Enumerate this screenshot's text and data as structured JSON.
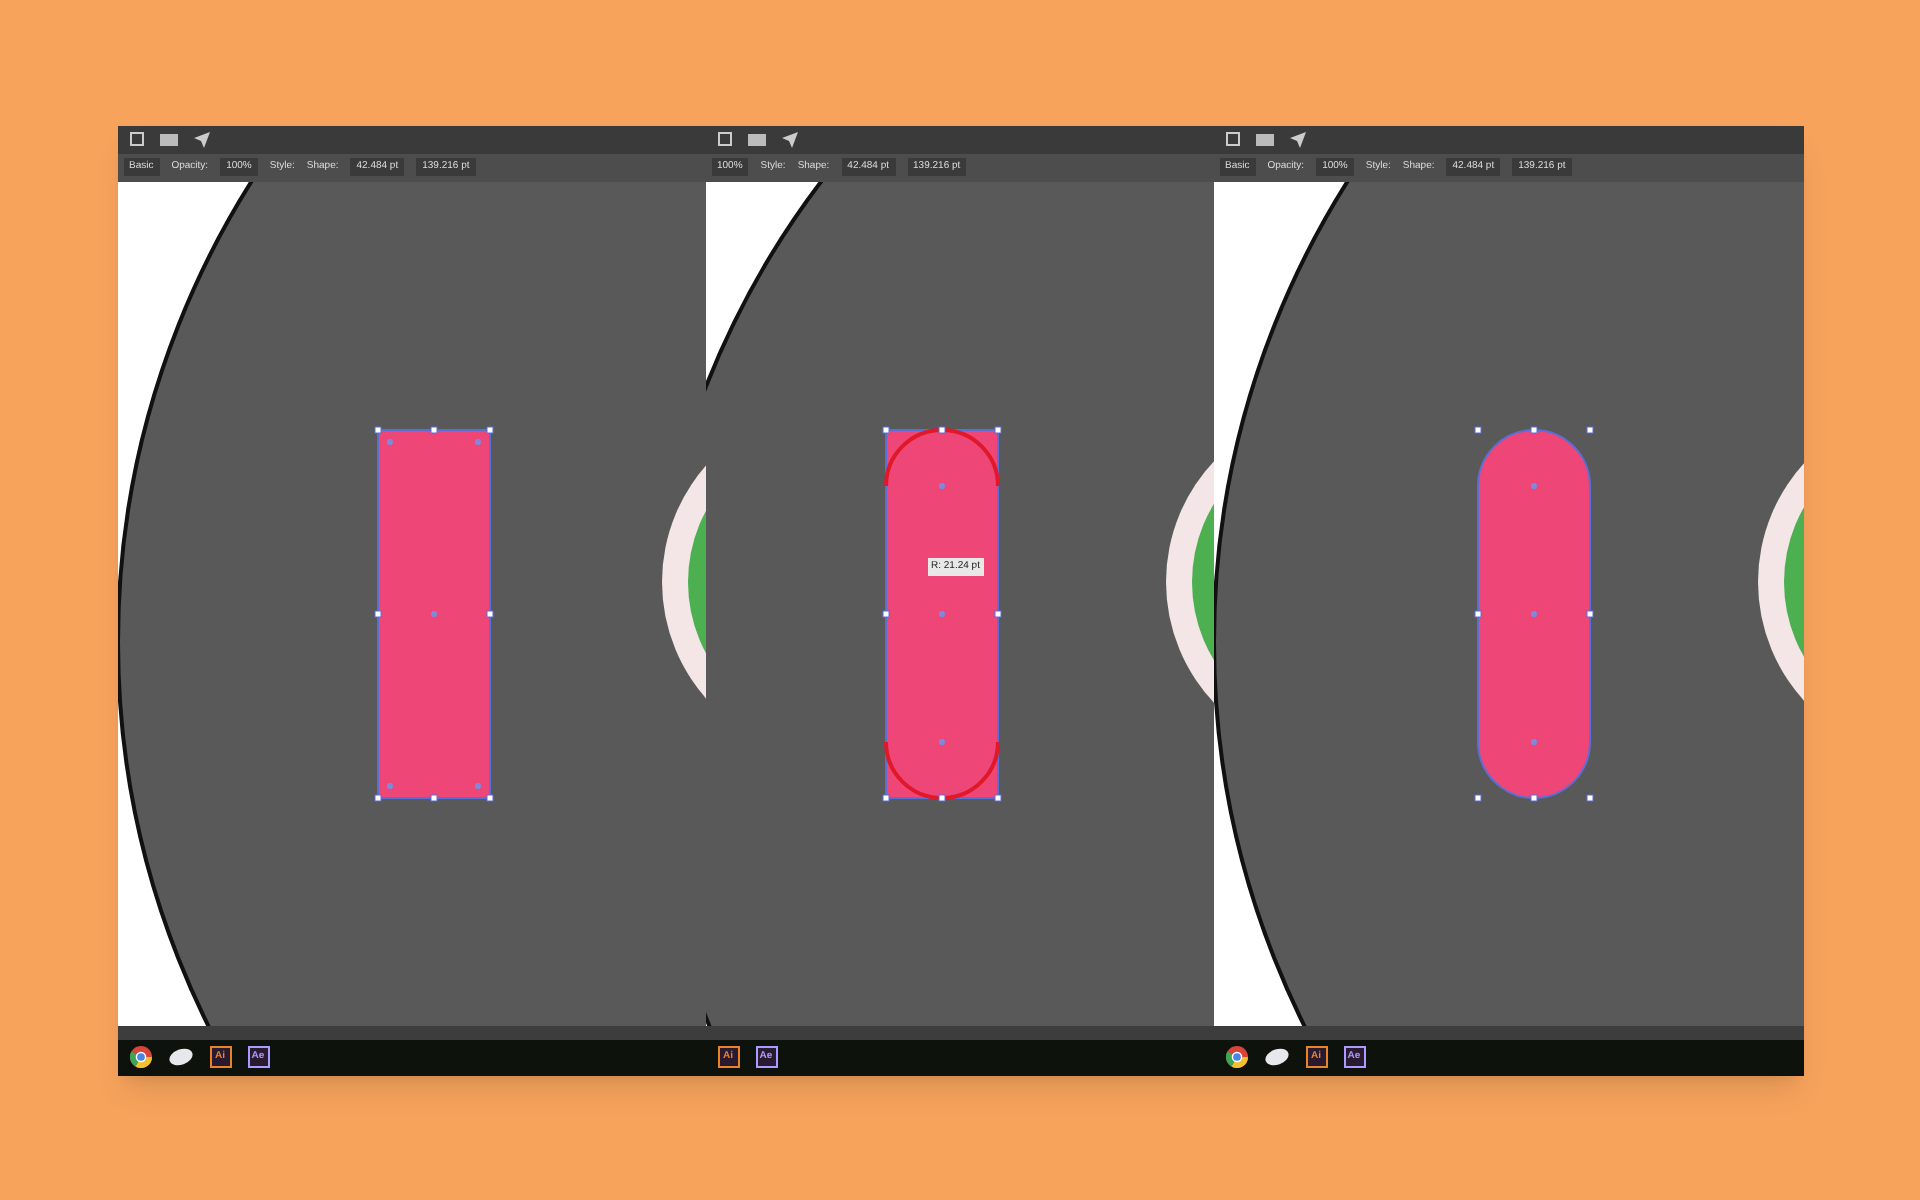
{
  "panels": [
    {
      "kind": "square",
      "controls": [
        {
          "kind": "field",
          "text": "Basic"
        },
        {
          "kind": "label",
          "text": "Opacity:"
        },
        {
          "kind": "field",
          "text": "100%"
        },
        {
          "kind": "label",
          "text": "Style:"
        },
        {
          "kind": "label",
          "text": "Shape:"
        },
        {
          "kind": "field",
          "text": "42.484 pt"
        },
        {
          "kind": "field",
          "text": "139.216 pt"
        }
      ],
      "taskbar": [
        {
          "kind": "browser"
        },
        {
          "kind": "mouse"
        },
        {
          "kind": "app",
          "text": "Ai",
          "color": "#e8832a"
        },
        {
          "kind": "app",
          "text": "Ae",
          "color": "#a99bff"
        }
      ]
    },
    {
      "kind": "rounding",
      "tooltip": "R: 21.24 pt",
      "controls": [
        {
          "kind": "field",
          "text": "100%"
        },
        {
          "kind": "label",
          "text": "Style:"
        },
        {
          "kind": "label",
          "text": "Shape:"
        },
        {
          "kind": "field",
          "text": "42.484 pt"
        },
        {
          "kind": "field",
          "text": "139.216 pt"
        }
      ],
      "taskbar": [
        {
          "kind": "app",
          "text": "Ai",
          "color": "#e8832a"
        },
        {
          "kind": "app",
          "text": "Ae",
          "color": "#a99bff"
        }
      ]
    },
    {
      "kind": "rounded",
      "controls": [
        {
          "kind": "field",
          "text": "Basic"
        },
        {
          "kind": "label",
          "text": "Opacity:"
        },
        {
          "kind": "field",
          "text": "100%"
        },
        {
          "kind": "label",
          "text": "Style:"
        },
        {
          "kind": "label",
          "text": "Shape:"
        },
        {
          "kind": "field",
          "text": "42.484 pt"
        },
        {
          "kind": "field",
          "text": "139.216 pt"
        }
      ],
      "taskbar": [
        {
          "kind": "browser"
        },
        {
          "kind": "mouse"
        },
        {
          "kind": "app",
          "text": "Ai",
          "color": "#e8832a"
        },
        {
          "kind": "app",
          "text": "Ae",
          "color": "#a99bff"
        }
      ]
    }
  ]
}
